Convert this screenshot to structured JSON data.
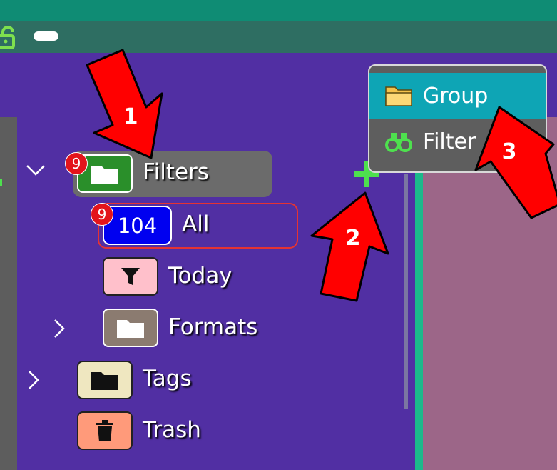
{
  "colors": {
    "sidebar_bg": "#512fa3",
    "filters_icon": "#2a8f2a",
    "all_icon": "#0000f0",
    "today_icon": "#ffc0cb",
    "formats_icon": "#8b7b70",
    "tags_icon": "#efe7c0",
    "trash_icon": "#ff9a7a",
    "badge": "#e3141b",
    "menu_active": "#0ea5b5",
    "arrow": "#ff0000"
  },
  "tree": {
    "filters": {
      "label": "Filters",
      "badge": "9",
      "icon": "folder-icon"
    },
    "all": {
      "label": "All",
      "count": "104",
      "badge": "9"
    },
    "today": {
      "label": "Today",
      "icon": "funnel-icon"
    },
    "formats": {
      "label": "Formats",
      "icon": "folder-icon"
    },
    "tags": {
      "label": "Tags",
      "icon": "folder-icon"
    },
    "trash": {
      "label": "Trash",
      "icon": "trash-icon"
    }
  },
  "menu": {
    "items": [
      {
        "label": "Group",
        "icon": "folder-icon",
        "active": true
      },
      {
        "label": "Filter",
        "icon": "binoculars-icon",
        "active": false
      }
    ]
  },
  "annotations": {
    "arrow1": "1",
    "arrow2": "2",
    "arrow3": "3"
  }
}
